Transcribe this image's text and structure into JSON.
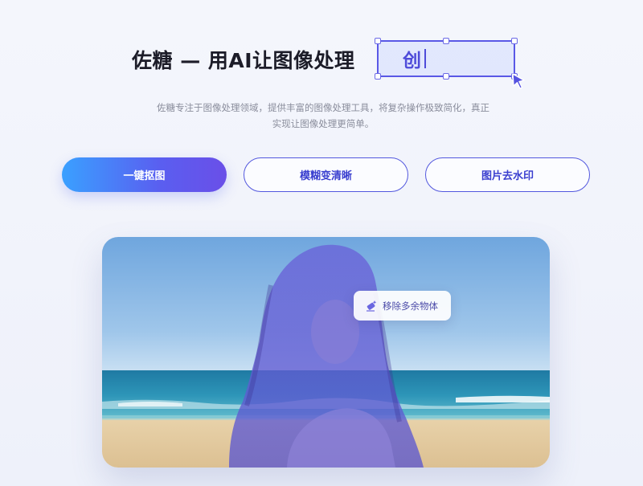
{
  "hero": {
    "title": "佐糖 — 用AI让图像处理",
    "typing_text": "创",
    "description": "佐糖专注于图像处理领域，提供丰富的图像处理工具，将复杂操作极致简化，真正实现让图像处理更简单。"
  },
  "tools": {
    "buttons": [
      {
        "label": "一键抠图",
        "active": true
      },
      {
        "label": "模糊变清晰",
        "active": false
      },
      {
        "label": "图片去水印",
        "active": false
      }
    ]
  },
  "preview": {
    "chip_label": "移除多余物体",
    "chip_icon": "eraser-sparkle-icon"
  },
  "colors": {
    "accent": "#5a58e6",
    "primary_gradient_start": "#3aa0ff",
    "primary_gradient_end": "#6a4fe8",
    "overlay": "#5b5bd6"
  }
}
